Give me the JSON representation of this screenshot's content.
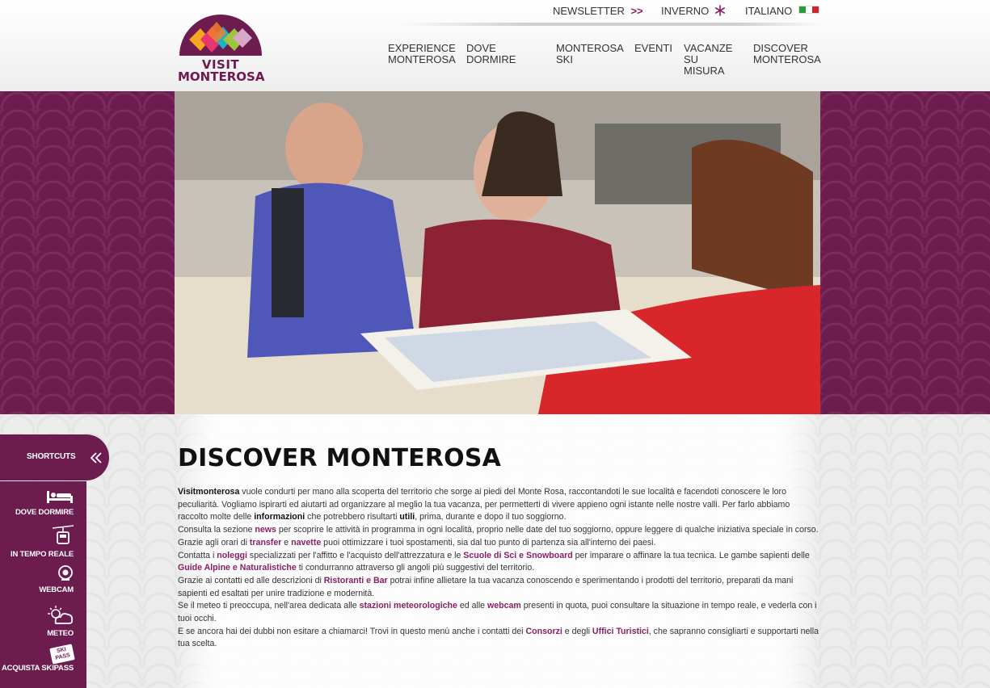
{
  "logo": {
    "line1": "VISIT",
    "line2": "MONTEROSA"
  },
  "topbar": {
    "newsletter": "NEWSLETTER",
    "newsletter_arrow": ">>",
    "season": "INVERNO",
    "language": "ITALIANO"
  },
  "nav": [
    {
      "label": "EXPERIENCE\nMONTEROSA"
    },
    {
      "label": "DOVE DORMIRE"
    },
    {
      "label": "MONTEROSA\nSKI"
    },
    {
      "label": "EVENTI"
    },
    {
      "label": "VACANZE\nSU MISURA"
    },
    {
      "label": "DISCOVER\nMONTEROSA"
    }
  ],
  "shortcuts": {
    "title": "SHORTCUTS",
    "items": [
      {
        "label": "DOVE DORMIRE",
        "icon": "bed-icon"
      },
      {
        "label": "IN TEMPO REALE",
        "icon": "cable-car-icon"
      },
      {
        "label": "WEBCAM",
        "icon": "webcam-icon"
      },
      {
        "label": "METEO",
        "icon": "weather-icon"
      },
      {
        "label": "ACQUISTA SKIPASS",
        "icon": "skipass-icon",
        "badge": "SKI PASS"
      }
    ]
  },
  "page": {
    "title": "DISCOVER MONTEROSA",
    "p1": {
      "strong": "Visitmonterosa",
      "t1": " vuole condurti per mano alla scoperta del territorio che sorge ai piedi del Monte Rosa, raccontandoti le sue località e facendoti conoscere le loro peculiarità. Vogliamo ispirarti ed aiutarti ad organizzare al meglio la tua vacanza, per permetterti di vivere appieno ogni istante nelle nostre valli. Per farlo abbiamo raccolto molte delle ",
      "strong2": "informazioni",
      "t2": " che potrebbero risultarti ",
      "strong3": "utili",
      "t3": ", prima, durante e dopo il tuo soggiorno."
    },
    "p2": {
      "t1": "Consulta la sezione ",
      "link": "news",
      "t2": " per scoprire le attività in programma in ogni località, proprio nelle date del tuo soggiorno, oppure leggere di qualche iniziativa speciale in corso. Grazie agli orari di ",
      "link2": "transfer",
      "t3": " e ",
      "link3": "navette",
      "t4": " puoi ottimizzare i tuoi spostamenti, sia dal tuo punto di partenza sia all'interno dei paesi."
    },
    "p3": {
      "t1": "Contatta i ",
      "link": "noleggi",
      "t2": " specializzati per l'affitto e l'acquisto dell'attrezzatura e le ",
      "link2": "Scuole di Sci e Snowboard",
      "t3": " per imparare o affinare la tua tecnica. Le gambe sapienti delle ",
      "link3": "Guide Alpine e Naturalistiche",
      "t4": " ti condurranno attraverso gli angoli più suggestivi del territorio."
    },
    "p4": {
      "t1": "Grazie ai contatti ed alle descrizioni di ",
      "link": "Ristoranti e Bar",
      "t2": " potrai infine allietare la tua vacanza conoscendo e sperimentando i prodotti del territorio, preparati da mani sapienti ed esaltati per unire tradizione e modernità."
    },
    "p5": {
      "t1": "Se il meteo ti preoccupa, nell'area dedicata alle ",
      "link": "stazioni meteorologiche",
      "t2": " ed alle ",
      "link2": "webcam",
      "t3": " presenti in quota, puoi consultare la situazione in tempo reale, e vederla con i tuoi occhi."
    },
    "p6": {
      "t1": "E se ancora hai dei dubbi non esitare a chiamarci! Trovi in questo menù anche i contatti dei ",
      "link": "Consorzi",
      "t2": " e degli ",
      "link2": "Uffici Turistici",
      "t3": ", che sapranno consigliarti e supportarti nella tua scelta."
    }
  },
  "colors": {
    "brand": "#6d1c4f",
    "link": "#8a1f63"
  }
}
